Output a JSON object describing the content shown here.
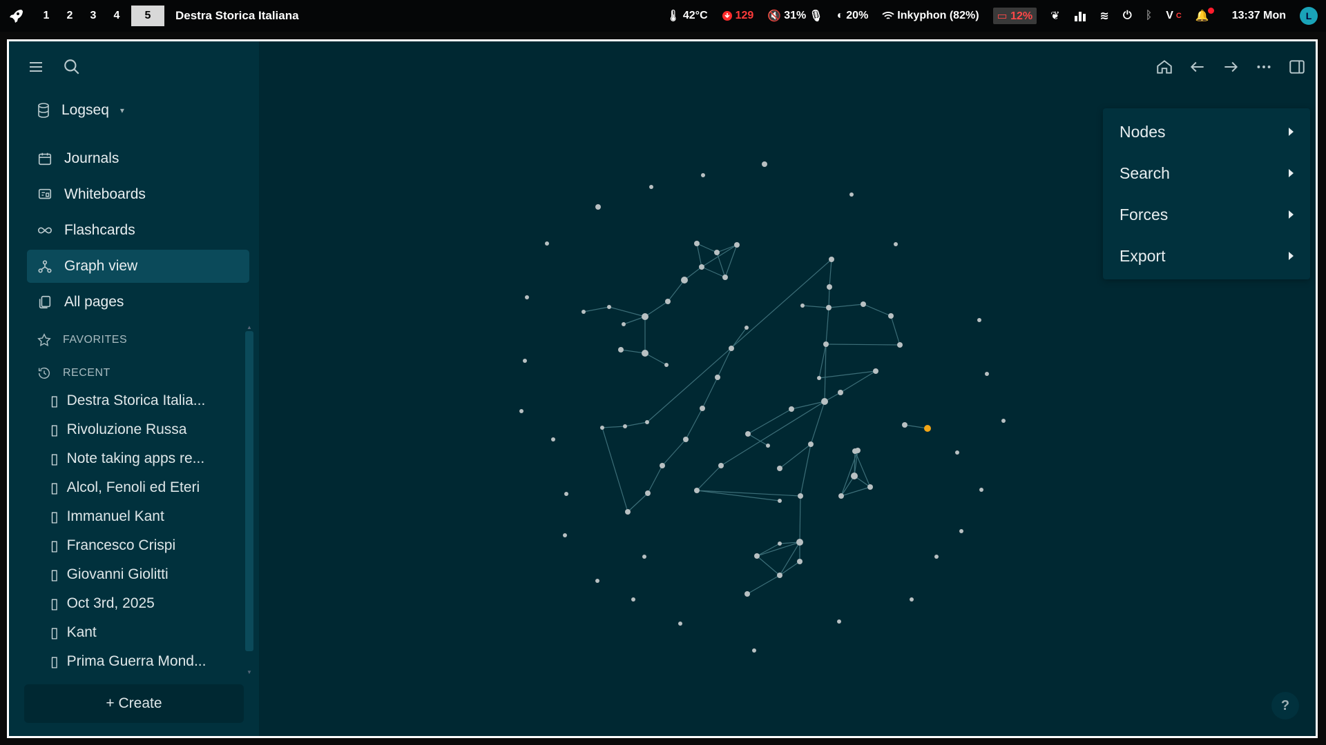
{
  "topbar": {
    "workspaces": [
      "1",
      "2",
      "3",
      "4",
      "5"
    ],
    "active_workspace": "5",
    "window_title": "Destra Storica Italiana",
    "temperature": "42°C",
    "updates": "129",
    "volume": "31%",
    "brightness": "20%",
    "wifi": "Inkyphon (82%)",
    "battery": "12%",
    "clock": "13:37 Mon",
    "avatar_letter": "L"
  },
  "sidebar": {
    "repo_name": "Logseq",
    "nav": [
      {
        "label": "Journals",
        "icon": "calendar-icon"
      },
      {
        "label": "Whiteboards",
        "icon": "whiteboard-icon"
      },
      {
        "label": "Flashcards",
        "icon": "infinity-icon"
      },
      {
        "label": "Graph view",
        "icon": "graph-icon"
      },
      {
        "label": "All pages",
        "icon": "pages-icon"
      }
    ],
    "favorites_label": "FAVORITES",
    "recent_label": "RECENT",
    "recent": [
      "Destra Storica Italia...",
      "Rivoluzione Russa",
      "Note taking apps re...",
      "Alcol, Fenoli ed Eteri",
      "Immanuel Kant",
      "Francesco Crispi",
      "Giovanni Giolitti",
      "Oct 3rd, 2025",
      "Kant",
      "Prima Guerra Mond..."
    ],
    "create_label": "+ Create"
  },
  "menu": {
    "items": [
      "Nodes",
      "Search",
      "Forces",
      "Export"
    ]
  },
  "help_label": "?",
  "colors": {
    "background": "#002832",
    "sidebar": "#01313d",
    "active_nav": "#0b4a5a",
    "node": "#b8c0c2",
    "edge": "#3c6e78",
    "highlight_node": "#f2a516"
  }
}
